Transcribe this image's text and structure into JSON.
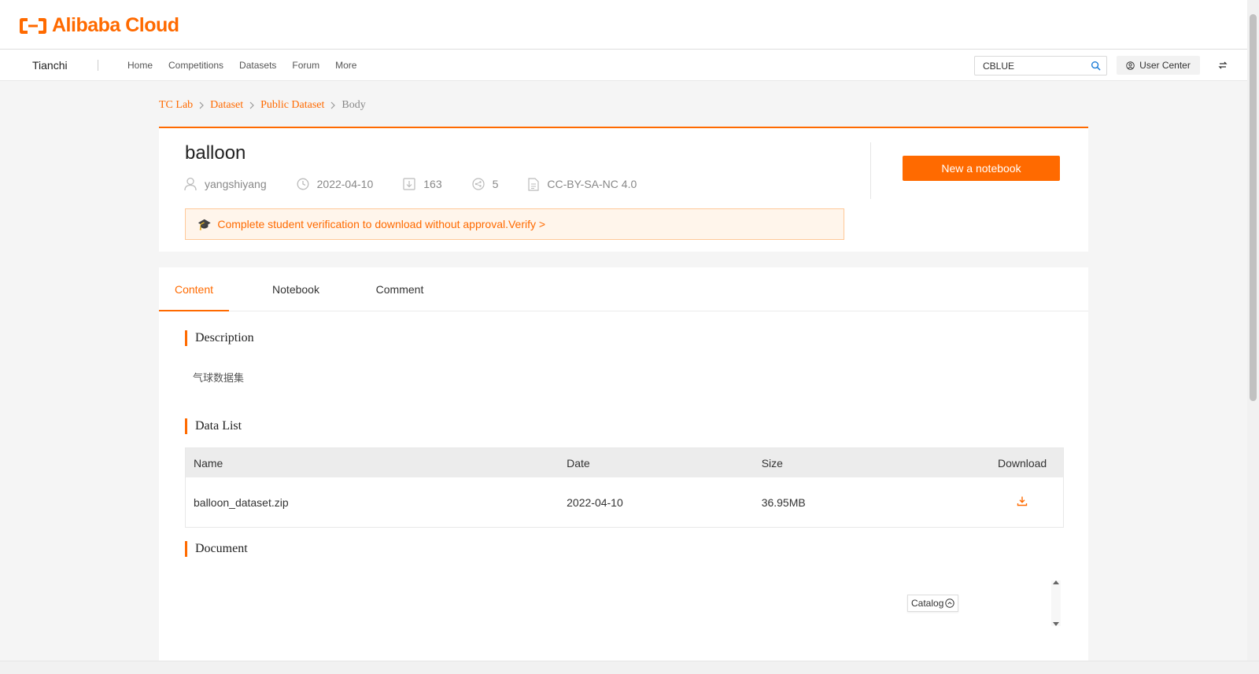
{
  "header": {
    "logo_text": "Alibaba Cloud",
    "logo_icon": "alibaba-cloud-icon",
    "brand_color": "#ff6a00"
  },
  "nav": {
    "brand": "Tianchi",
    "links": [
      "Home",
      "Competitions",
      "Datasets",
      "Forum",
      "More"
    ],
    "search_value": "CBLUE",
    "user_center_label": "User Center"
  },
  "breadcrumb": [
    "TC Lab",
    "Dataset",
    "Public Dataset",
    "Body"
  ],
  "dataset": {
    "title": "balloon",
    "author": "yangshiyang",
    "date": "2022-04-10",
    "downloads": "163",
    "shares": "5",
    "license": "CC-BY-SA-NC 4.0",
    "verify_cap": "🎓",
    "verify_text": "Complete student verification to download without approval.Verify >",
    "new_notebook_label": "New a notebook"
  },
  "tabs": [
    "Content",
    "Notebook",
    "Comment"
  ],
  "active_tab": "Content",
  "sections": {
    "description_title": "Description",
    "description_text": "气球数据集",
    "data_list_title": "Data List",
    "document_title": "Document"
  },
  "table": {
    "headers": [
      "Name",
      "Date",
      "Size",
      "Download"
    ],
    "rows": [
      {
        "name": "balloon_dataset.zip",
        "date": "2022-04-10",
        "size": "36.95MB"
      }
    ]
  },
  "catalog_label": "Catalog"
}
